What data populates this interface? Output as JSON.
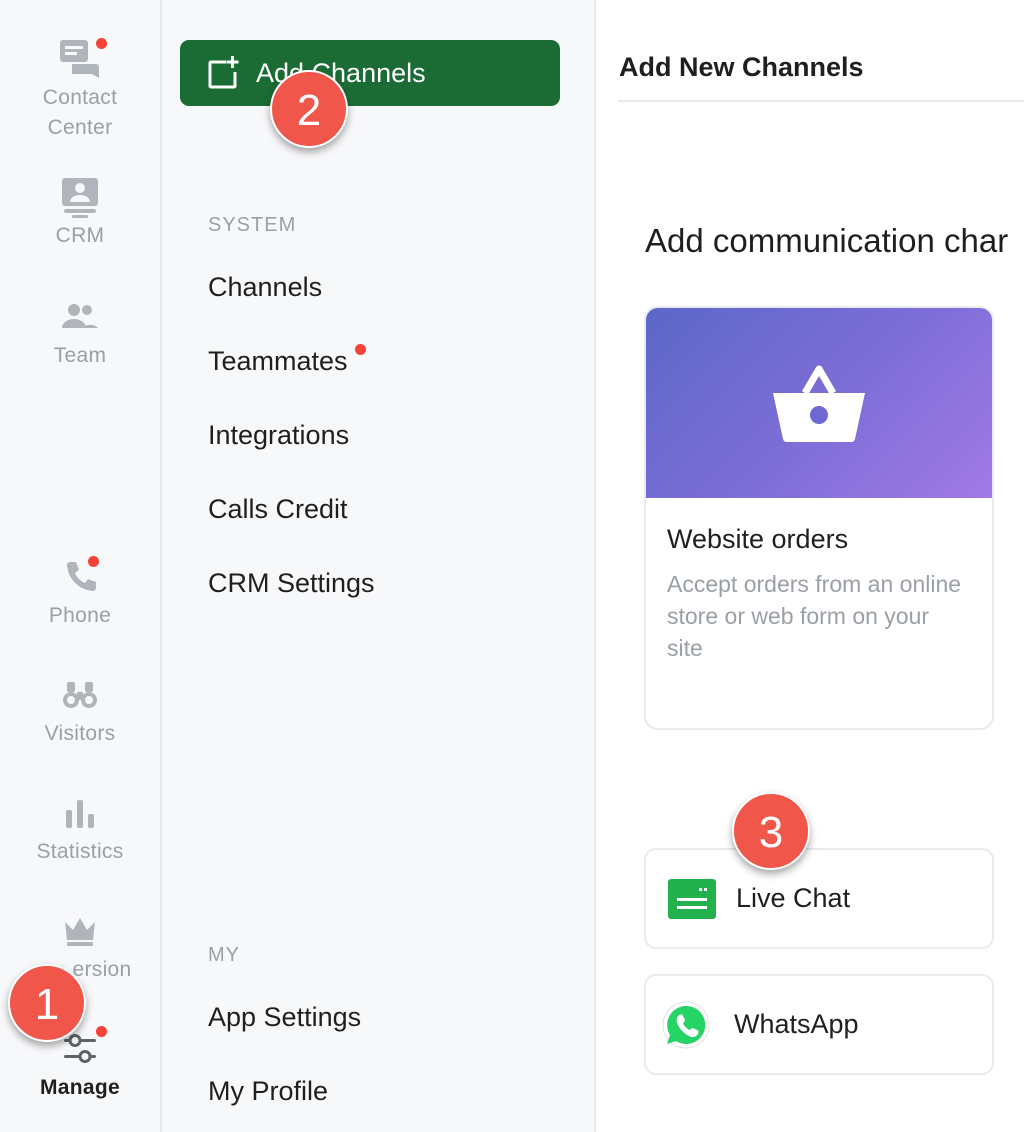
{
  "rail": {
    "contact_center": "Contact\nCenter",
    "contact_center_line1": "Contact",
    "contact_center_line2": "Center",
    "crm": "CRM",
    "team": "Team",
    "phone": "Phone",
    "visitors": "Visitors",
    "statistics": "Statistics",
    "version": "ersion",
    "manage": "Manage"
  },
  "menu": {
    "add_button": "Add Channels",
    "system_label": "SYSTEM",
    "system_items": [
      "Channels",
      "Teammates",
      "Integrations",
      "Calls Credit",
      "CRM Settings"
    ],
    "my_label": "MY",
    "my_items": [
      "App Settings",
      "My Profile"
    ]
  },
  "main": {
    "title": "Add New Channels",
    "subtitle": "Add communication char",
    "card": {
      "title": "Website orders",
      "description": "Accept orders from an online store or web form on your site",
      "icon": "basket-icon"
    },
    "channels": [
      {
        "label": "Live Chat",
        "icon": "live-chat-icon"
      },
      {
        "label": "WhatsApp",
        "icon": "whatsapp-icon"
      }
    ]
  },
  "steps": [
    "1",
    "2",
    "3"
  ],
  "colors": {
    "accent_green": "#1b6b35",
    "notification_red": "#f44336",
    "step_marker": "#f1564b",
    "card_gradient_start": "#5b67c8",
    "card_gradient_end": "#a27ae6",
    "live_chat_green": "#22b14c",
    "whatsapp_green": "#25d366"
  }
}
